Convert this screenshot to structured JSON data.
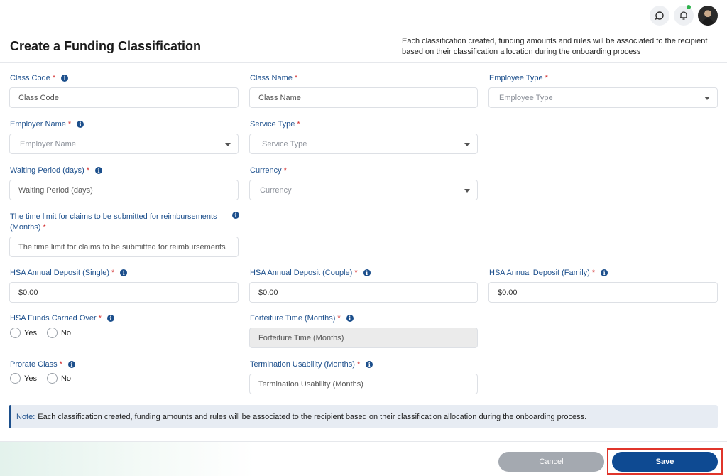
{
  "topbar": {
    "icons": [
      "help-icon",
      "bell-icon"
    ],
    "notification_dot_color": "#2fb24c"
  },
  "header": {
    "title": "Create a Funding Classification",
    "description": "Each classification created, funding amounts and rules will be associated to the recipient based on their classification allocation during the onboarding process"
  },
  "form": {
    "class_code": {
      "label": "Class Code",
      "required": "*",
      "placeholder": "Class Code"
    },
    "class_name": {
      "label": "Class Name",
      "required": "*",
      "placeholder": "Class Name"
    },
    "employee_type": {
      "label": "Employee Type",
      "required": "*",
      "placeholder": "Employee Type"
    },
    "employer_name": {
      "label": "Employer Name",
      "required": "*",
      "placeholder": "Employer Name"
    },
    "service_type": {
      "label": "Service Type",
      "required": "*",
      "placeholder": "Service Type"
    },
    "waiting_period": {
      "label": "Waiting Period (days)",
      "required": "*",
      "placeholder": "Waiting Period (days)"
    },
    "currency": {
      "label": "Currency",
      "required": "*",
      "placeholder": "Currency"
    },
    "claims_time_limit": {
      "label": "The time limit for claims to be submitted for reimbursements (Months)",
      "required": "*",
      "placeholder": "The time limit for claims to be submitted for reimbursements"
    },
    "hsa_single": {
      "label": "HSA Annual Deposit (Single)",
      "required": "*",
      "value": "$0.00"
    },
    "hsa_couple": {
      "label": "HSA Annual Deposit (Couple)",
      "required": "*",
      "value": "$0.00"
    },
    "hsa_family": {
      "label": "HSA Annual Deposit (Family)",
      "required": "*",
      "value": "$0.00"
    },
    "hsa_carried_over": {
      "label": "HSA Funds Carried Over",
      "required": "*",
      "options": [
        "Yes",
        "No"
      ]
    },
    "forfeiture_time": {
      "label": "Forfeiture Time (Months)",
      "required": "*",
      "placeholder": "Forfeiture Time (Months)"
    },
    "prorate_class": {
      "label": "Prorate Class",
      "required": "*",
      "options": [
        "Yes",
        "No"
      ]
    },
    "termination_usability": {
      "label": "Termination Usability (Months)",
      "required": "*",
      "placeholder": "Termination Usability (Months)"
    }
  },
  "note": {
    "label": "Note:",
    "text": "Each classification created, funding amounts and rules will be associated to the recipient based on their classification allocation during the onboarding process."
  },
  "footer": {
    "cancel_label": "Cancel",
    "save_label": "Save"
  },
  "colors": {
    "primary": "#0e4a92",
    "label": "#1c4f8c",
    "required": "#d32f2f",
    "highlight": "#e0352b"
  }
}
